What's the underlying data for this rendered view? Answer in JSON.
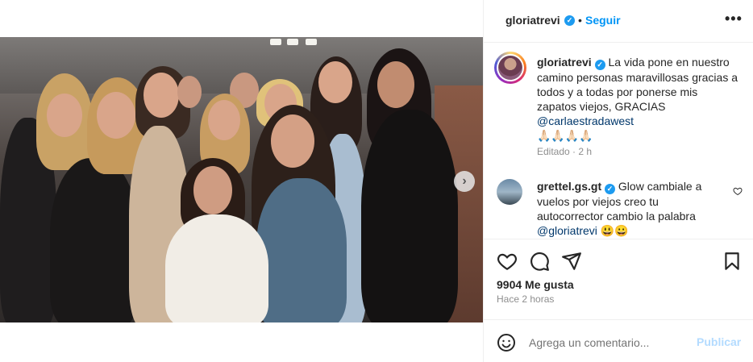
{
  "post": {
    "username": "gloriatrevi",
    "separator": "•",
    "follow_label": "Seguir",
    "more_label": "•••"
  },
  "caption": {
    "username": "gloriatrevi",
    "text": "La vida pone en nuestro camino personas maravillosas gracias a todos y a todas por ponerse mis zapatos viejos, GRACIAS ",
    "mention": "@carlaestradawest",
    "emojis": "🙏🏻🙏🏻🙏🏻🙏🏻",
    "edited": "Editado · 2 h"
  },
  "comment": {
    "username": "grettel.gs.gt",
    "text": "Glow cambiale a vuelos por viejos creo tu autocorrector cambio la palabra ",
    "mention": "@gloriatrevi",
    "emojis": " 😃😀"
  },
  "stats": {
    "likes": "9904 Me gusta",
    "time_ago": "Hace 2 horas"
  },
  "add_comment": {
    "placeholder": "Agrega un comentario...",
    "publish_label": "Publicar"
  },
  "icons": {
    "verified": "verified-badge-icon",
    "next": "chevron-right-icon",
    "like": "heart-icon",
    "comment": "comment-bubble-icon",
    "share": "paper-plane-icon",
    "save": "bookmark-icon",
    "emoji": "smiley-icon"
  },
  "colors": {
    "accent": "#0095f6",
    "verified": "#1d9bf0",
    "muted": "#8e8e8e",
    "mention": "#00376b",
    "publish_disabled": "#b3dbff"
  }
}
